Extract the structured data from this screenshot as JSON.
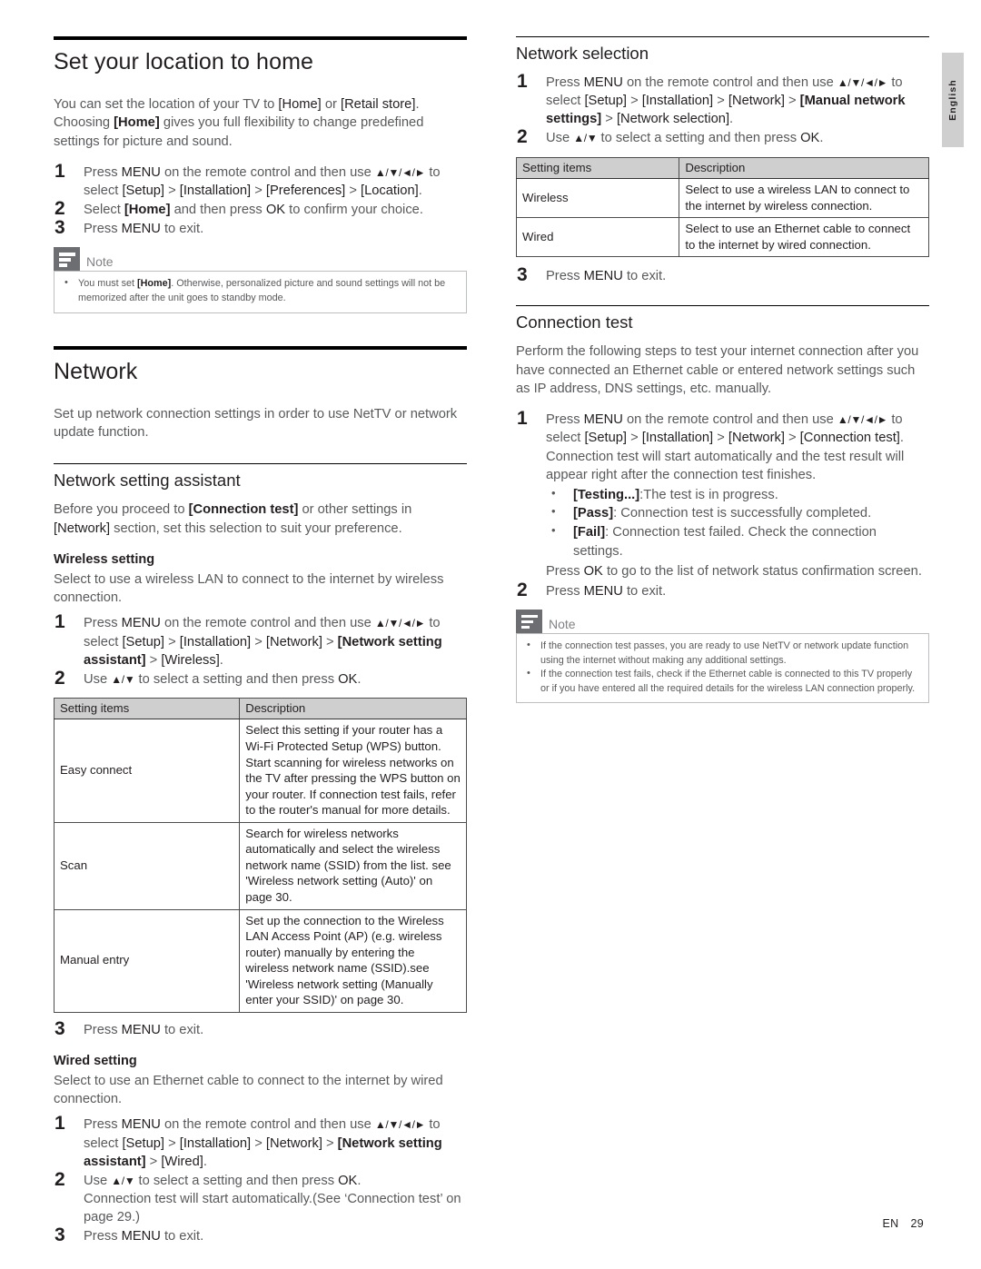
{
  "language_tab": {
    "label": "English"
  },
  "footer": {
    "code": "EN",
    "page": "29"
  },
  "note_label": "Note",
  "left_column": {
    "section1": {
      "title": "Set your location to home",
      "intro": "You can set the location of your TV to [Home] or [Retail store]. Choosing [Home] gives you full flexibility to change predefined settings for picture and sound.",
      "steps": [
        "Press MENU on the remote control and then use ▲/▼/◄/► to select [Setup] > [Installation] > [Preferences] > [Location].",
        "Select [Home] and then press OK to confirm your choice.",
        "Press MENU to exit."
      ],
      "note": [
        "You must set [Home]. Otherwise, personalized picture and sound settings will not be memorized after the unit goes to standby mode."
      ]
    },
    "section2": {
      "title": "Network",
      "intro": "Set up network connection settings in order to use NetTV or network update function.",
      "subsection": {
        "title": "Network setting assistant",
        "intro": "Before you proceed to [Connection test] or other settings in [Network] section, set this selection to suit your preference.",
        "wireless": {
          "heading": "Wireless setting",
          "intro": "Select to use a wireless LAN to connect to the internet by wireless connection.",
          "steps": [
            "Press MENU on the remote control and then use ▲/▼/◄/► to select [Setup] > [Installation] > [Network] > [Network setting assistant] > [Wireless].",
            "Use ▲/▼ to select a setting and then press OK."
          ],
          "table": {
            "headers": [
              "Setting items",
              "Description"
            ],
            "rows": [
              {
                "item": "Easy connect",
                "description": "Select this setting if your router has a Wi-Fi Protected Setup (WPS) button. Start scanning for wireless networks on the TV after pressing the WPS button on your router. If connection test fails, refer to the router's manual for more details."
              },
              {
                "item": "Scan",
                "description": "Search for wireless networks automatically and select the wireless network name (SSID) from the list. see 'Wireless network setting (Auto)' on page 30."
              },
              {
                "item": "Manual entry",
                "description": "Set up the connection to the Wireless LAN Access Point (AP) (e.g. wireless router) manually by entering the wireless network name (SSID).see 'Wireless network setting (Manually enter your SSID)' on page 30."
              }
            ]
          },
          "final_step": "Press MENU to exit."
        },
        "wired": {
          "heading": "Wired setting",
          "intro": "Select to use an Ethernet cable to connect to the internet by wired connection.",
          "steps": [
            "Press MENU on the remote control and then use ▲/▼/◄/► to select [Setup] > [Installation] > [Network] > [Network setting assistant] > [Wired].",
            "Use ▲/▼ to select a setting and then press OK. Connection test will start automatically.(See 'Connection test' on page 29.)",
            "Press MENU to exit."
          ]
        }
      }
    }
  },
  "right_column": {
    "network_selection": {
      "title": "Network selection",
      "steps": [
        "Press MENU on the remote control and then use ▲/▼/◄/► to select [Setup] > [Installation] > [Network] > [Manual network settings] > [Network selection].",
        "Use ▲/▼ to select a setting and then press OK."
      ],
      "table": {
        "headers": [
          "Setting items",
          "Description"
        ],
        "rows": [
          {
            "item": "Wireless",
            "description": "Select to use a wireless LAN to connect to the internet by wireless connection."
          },
          {
            "item": "Wired",
            "description": "Select to use an Ethernet cable to connect to the internet by wired connection."
          }
        ]
      },
      "final_step": "Press MENU to exit."
    },
    "connection_test": {
      "title": "Connection test",
      "intro": "Perform the following steps to test your internet connection after you have connected an Ethernet cable or entered network settings such as IP address, DNS settings, etc. manually.",
      "step1": "Press MENU on the remote control and then use ▲/▼/◄/► to select [Setup] > [Installation] > [Network] > [Connection test]. Connection test will start automatically and the test result will appear right after the connection test finishes.",
      "bullets": [
        "[Testing...]: The test is in progress.",
        "[Pass]: Connection test is successfully completed.",
        "[Fail]: Connection test failed. Check the connection settings."
      ],
      "bullet_footer": "Press OK to go to the list of network status confirmation screen.",
      "step2": "Press MENU to exit.",
      "note": [
        "If the connection test passes, you are ready to use NetTV or network update function using the internet without making any additional settings.",
        "If the connection test fails, check if the Ethernet cable is connected to this TV properly or if you have entered all the required details for the wireless LAN connection properly."
      ]
    }
  }
}
